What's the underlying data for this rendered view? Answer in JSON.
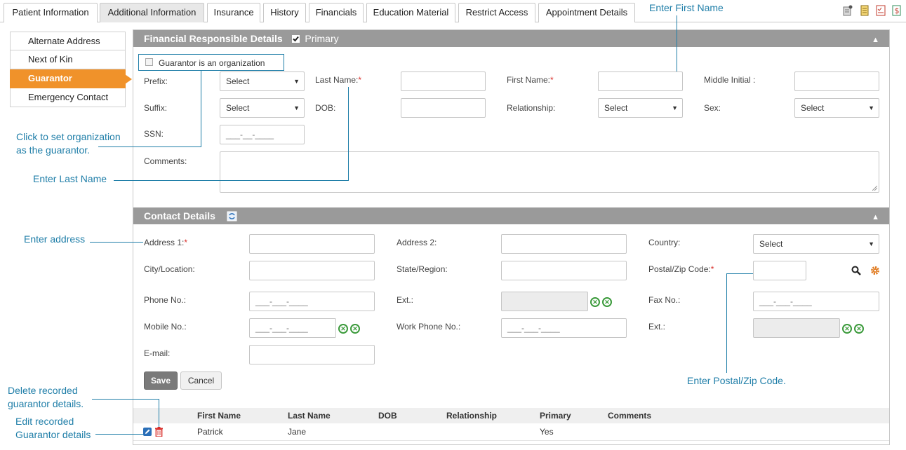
{
  "tabs": [
    "Patient Information",
    "Additional Information",
    "Insurance",
    "History",
    "Financials",
    "Education Material",
    "Restrict Access",
    "Appointment Details"
  ],
  "active_tab": "Additional Information",
  "sidebar": {
    "items": [
      {
        "label": "Alternate Address"
      },
      {
        "label": "Next of Kin"
      },
      {
        "label": "Guarantor"
      },
      {
        "label": "Emergency Contact"
      }
    ],
    "active": "Guarantor"
  },
  "financial": {
    "title": "Financial Responsible Details",
    "primary_label": "Primary",
    "primary_checked": true,
    "org_checkbox_label": "Guarantor is an organization",
    "prefix_label": "Prefix:",
    "prefix_value": "Select",
    "lastname_label": "Last Name:",
    "firstname_label": "First Name:",
    "middle_label": "Middle Initial :",
    "suffix_label": "Suffix:",
    "suffix_value": "Select",
    "dob_label": "DOB:",
    "relationship_label": "Relationship:",
    "relationship_value": "Select",
    "sex_label": "Sex:",
    "sex_value": "Select",
    "ssn_label": "SSN:",
    "ssn_placeholder": "___-__-____",
    "comments_label": "Comments:",
    "required_mark": "*"
  },
  "contact": {
    "title": "Contact Details",
    "address1_label": "Address 1:",
    "address2_label": "Address 2:",
    "country_label": "Country:",
    "country_value": "Select",
    "city_label": "City/Location:",
    "state_label": "State/Region:",
    "postal_label": "Postal/Zip Code:",
    "phone_label": "Phone No.:",
    "phone_placeholder": "___-___-____",
    "ext_label": "Ext.:",
    "fax_label": "Fax No.:",
    "fax_placeholder": "___-___-____",
    "mobile_label": "Mobile No.:",
    "mobile_placeholder": "___-___-____",
    "work_label": "Work Phone No.:",
    "work_placeholder": "___-___-____",
    "ext2_label": "Ext.:",
    "email_label": "E-mail:",
    "required_mark": "*"
  },
  "buttons": {
    "save": "Save",
    "cancel": "Cancel"
  },
  "table": {
    "headers": [
      "First Name",
      "Last Name",
      "DOB",
      "Relationship",
      "Primary",
      "Comments"
    ],
    "rows": [
      {
        "first": "Patrick",
        "last": "Jane",
        "dob": "",
        "relationship": "",
        "primary": "Yes",
        "comments": ""
      }
    ]
  },
  "callouts": {
    "first_name": "Enter First Name",
    "org_line1": "Click to set organization",
    "org_line2": "as the guarantor.",
    "last_name": "Enter Last Name",
    "address": "Enter address",
    "postal": "Enter Postal/Zip Code.",
    "delete_line1": "Delete recorded",
    "delete_line2": "guarantor details.",
    "edit_line1": "Edit recorded",
    "edit_line2": "Guarantor details"
  },
  "colors": {
    "accent": "#f0922a",
    "section_header": "#9a9a9a",
    "callout": "#1f7ea8",
    "required": "#d9302c",
    "icon_green": "#3b9a3b"
  },
  "icons": [
    "notes-icon",
    "document-icon",
    "checklist-icon",
    "dollar-doc-icon",
    "search-icon",
    "gear-icon",
    "refresh-icon",
    "edit-icon",
    "trash-icon",
    "phone-call-icon",
    "sms-icon",
    "chevron-up-icon"
  ]
}
